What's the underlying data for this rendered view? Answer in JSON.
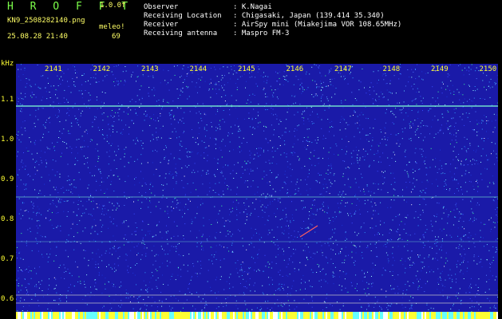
{
  "header": {
    "app_title": "H R O F F T",
    "version": "1.0.0f",
    "filename": "KN9_2508282140.png",
    "meleo_label": "meleo!",
    "datetime": "25.08.28 21:40",
    "meleo_count": "69"
  },
  "info": {
    "observer_label": "Observer",
    "observer_value": ": K.Nagai",
    "location_label": "Receiving Location",
    "location_value": ": Chigasaki, Japan (139.414 35.340)",
    "receiver_label": "Receiver",
    "receiver_value": ": AirSpy mini (Miakejima VOR 108.65MHz)",
    "antenna_label": "Receiving antenna",
    "antenna_value": ": Maspro FM-3"
  },
  "axis": {
    "unit": "kHz",
    "y_ticks": [
      "1.1",
      "1.0",
      "0.9",
      "0.8",
      "0.7",
      "0.6"
    ],
    "x_ticks": [
      "2141",
      "2142",
      "2143",
      "2144",
      "2145",
      "2146",
      "2147",
      "2148",
      "2149",
      "2150"
    ]
  },
  "colors": {
    "header_text": "#7cff4a",
    "accent_text": "#ffff66",
    "background": "#000000",
    "spectrogram_base": "#1a1aa8",
    "signal_line": "#7fffd4",
    "meteor_trace": "#ff6060"
  }
}
